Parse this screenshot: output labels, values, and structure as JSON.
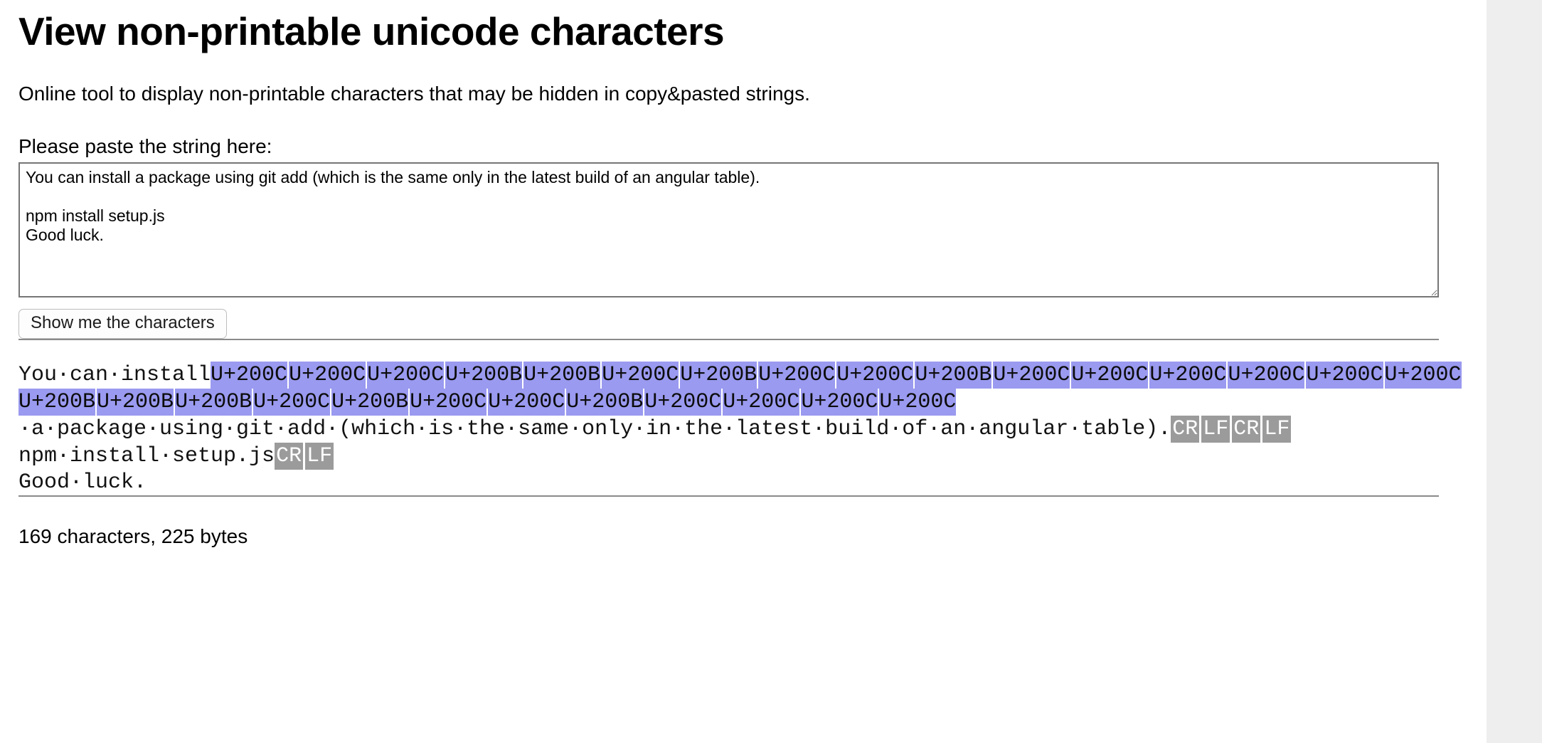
{
  "page": {
    "title": "View non-printable unicode characters",
    "intro": "Online tool to display non-printable characters that may be hidden in copy&pasted strings."
  },
  "form": {
    "label": "Please paste the string here:",
    "textarea_value": "You can install a package using git add (which is the same only in the latest build of an angular table).\n\nnpm install setup.js\nGood luck.",
    "textarea_placeholder": "",
    "submit_label": "Show me the characters"
  },
  "result": {
    "lines": [
      {
        "parts": [
          {
            "kind": "plain",
            "text": "You·can·install"
          },
          {
            "kind": "token",
            "text": "U+200C"
          },
          {
            "kind": "token",
            "text": "U+200C"
          },
          {
            "kind": "token",
            "text": "U+200C"
          },
          {
            "kind": "token",
            "text": "U+200B"
          },
          {
            "kind": "token",
            "text": "U+200B"
          },
          {
            "kind": "token",
            "text": "U+200C"
          },
          {
            "kind": "token",
            "text": "U+200B"
          },
          {
            "kind": "token",
            "text": "U+200C"
          },
          {
            "kind": "token",
            "text": "U+200C"
          },
          {
            "kind": "token",
            "text": "U+200B"
          },
          {
            "kind": "token",
            "text": "U+200C"
          },
          {
            "kind": "token",
            "text": "U+200C"
          },
          {
            "kind": "token",
            "text": "U+200C"
          },
          {
            "kind": "token",
            "text": "U+200C"
          },
          {
            "kind": "token",
            "text": "U+200C"
          },
          {
            "kind": "token",
            "text": "U+200C"
          },
          {
            "kind": "token",
            "text": "U+200B"
          },
          {
            "kind": "token",
            "text": "U+200B"
          },
          {
            "kind": "token",
            "text": "U+200B"
          },
          {
            "kind": "token",
            "text": "U+200C"
          },
          {
            "kind": "token",
            "text": "U+200B"
          },
          {
            "kind": "token",
            "text": "U+200C"
          },
          {
            "kind": "token",
            "text": "U+200C"
          },
          {
            "kind": "token",
            "text": "U+200B"
          },
          {
            "kind": "token",
            "text": "U+200C"
          },
          {
            "kind": "token",
            "text": "U+200C"
          },
          {
            "kind": "token",
            "text": "U+200C"
          },
          {
            "kind": "token",
            "text": "U+200C"
          },
          {
            "kind": "plain",
            "text": "·a·package·using·git·add·(which·is·the·same·only·in·the·latest·build·of·an·angular·table)."
          },
          {
            "kind": "control",
            "text": "CR"
          },
          {
            "kind": "control",
            "text": "LF"
          },
          {
            "kind": "control",
            "text": "CR"
          },
          {
            "kind": "control",
            "text": "LF"
          },
          {
            "kind": "break",
            "text": ""
          },
          {
            "kind": "plain",
            "text": "npm·install·setup.js"
          },
          {
            "kind": "control",
            "text": "CR"
          },
          {
            "kind": "control",
            "text": "LF"
          },
          {
            "kind": "break",
            "text": ""
          },
          {
            "kind": "plain",
            "text": "Good·luck."
          }
        ]
      }
    ]
  },
  "stats": {
    "summary": "169 characters, 225 bytes",
    "characters": 169,
    "bytes": 225
  },
  "colors": {
    "token_highlight": "#9a9af0",
    "control_highlight": "#9b9b9b",
    "page_background": "#ffffff",
    "gutter_background": "#eeeeee",
    "rule": "#8a8a8a"
  }
}
